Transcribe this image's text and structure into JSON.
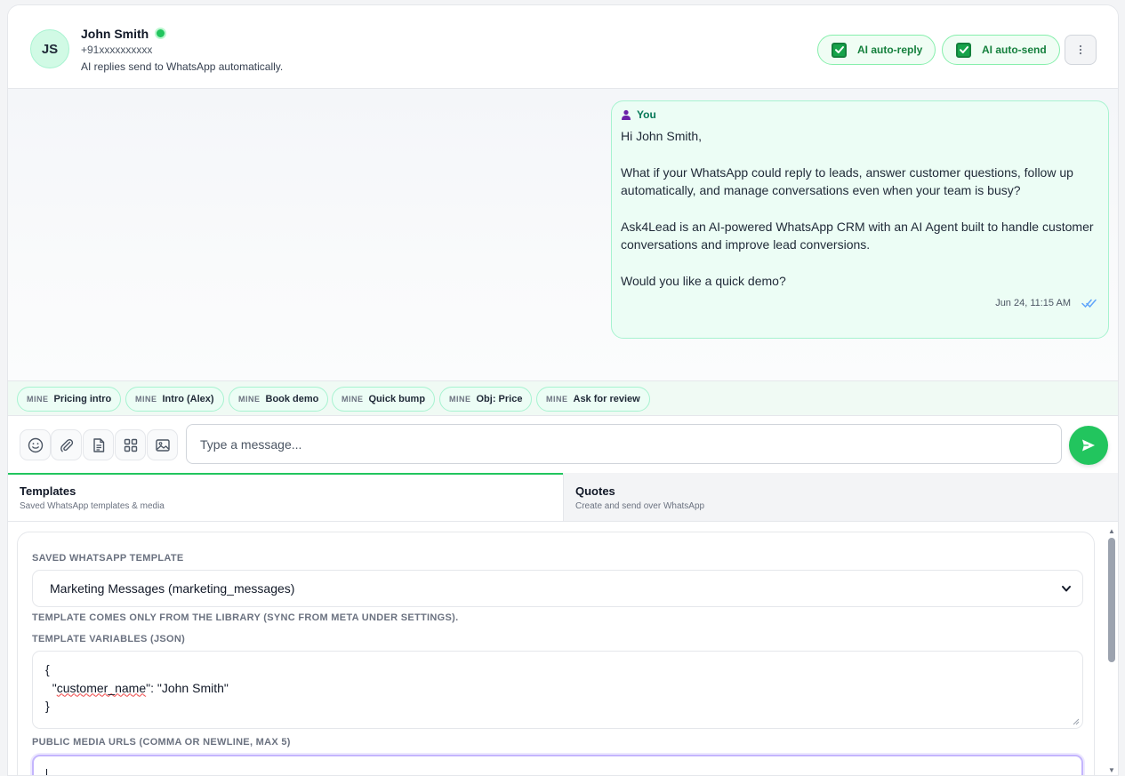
{
  "contact": {
    "initials": "JS",
    "name": "John Smith",
    "status": "online",
    "phone": "+91xxxxxxxxxx",
    "subtitle": "AI replies send to WhatsApp automatically."
  },
  "toggles": [
    {
      "label": "AI auto-reply",
      "checked": true
    },
    {
      "label": "AI auto-send",
      "checked": true
    }
  ],
  "message": {
    "sender": "You",
    "paragraphs": [
      "Hi John Smith,",
      "What if your WhatsApp could reply to leads, answer customer questions, follow up automatically, and manage conversations even when your team is busy?",
      "Ask4Lead is an AI-powered WhatsApp CRM with an AI Agent built to handle customer conversations and improve lead conversions.",
      "Would you like a quick demo?"
    ],
    "timestamp": "Jun 24, 11:15 AM",
    "read": true
  },
  "quick_replies": [
    {
      "tag": "MINE",
      "label": "Pricing intro"
    },
    {
      "tag": "MINE",
      "label": "Intro (Alex)"
    },
    {
      "tag": "MINE",
      "label": "Book demo"
    },
    {
      "tag": "MINE",
      "label": "Quick bump"
    },
    {
      "tag": "MINE",
      "label": "Obj: Price"
    },
    {
      "tag": "MINE",
      "label": "Ask for review"
    }
  ],
  "composer": {
    "placeholder": "Type a message...",
    "tools": [
      "emoji-icon",
      "paperclip-icon",
      "document-icon",
      "grid-icon",
      "image-icon"
    ]
  },
  "tabs": [
    {
      "title": "Templates",
      "subtitle": "Saved WhatsApp templates & media",
      "active": true
    },
    {
      "title": "Quotes",
      "subtitle": "Create and send over WhatsApp",
      "active": false
    }
  ],
  "templates_panel": {
    "saved_label": "Saved WhatsApp template",
    "selected_template": "Marketing Messages (marketing_messages)",
    "library_note": "Template comes only from the library (sync from Meta under Settings).",
    "variables_label": "Template variables (JSON)",
    "variables_lines": [
      "{",
      "  \"customer_name\": \"John Smith\"",
      "}"
    ],
    "media_label": "Public media URLs (comma or newline, max 5)",
    "media_value": ""
  },
  "colors": {
    "accent": "#22c55e",
    "bubble_bg": "#ecfdf5",
    "bubble_border": "#a7f3d0",
    "toggle_text": "#15803d"
  }
}
